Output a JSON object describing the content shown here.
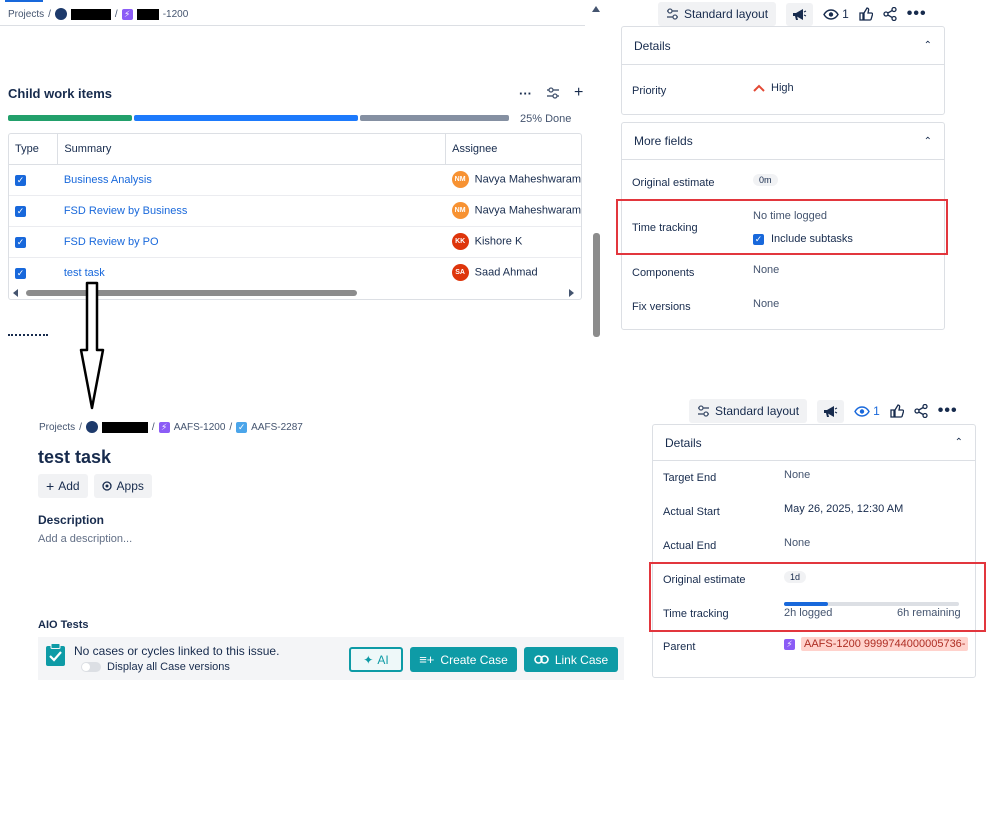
{
  "top": {
    "breadcrumb": {
      "projects": "Projects",
      "sep": "/",
      "issue_suffix": "-1200"
    },
    "toolbar": {
      "standard_layout": "Standard layout",
      "watch_count": "1"
    },
    "child_items": {
      "title": "Child work items",
      "progress_label": "25% Done",
      "progress": {
        "done": 0.25,
        "in_progress": 0.45,
        "todo": 0.3
      },
      "columns": [
        "Type",
        "Summary",
        "Assignee"
      ],
      "rows": [
        {
          "summary": "Business Analysis",
          "initials": "NM",
          "assignee": "Navya Maheshwaram",
          "color": "#f79232"
        },
        {
          "summary": "FSD Review by Business",
          "initials": "NM",
          "assignee": "Navya Maheshwaram",
          "color": "#f79232"
        },
        {
          "summary": "FSD Review by PO",
          "initials": "KK",
          "assignee": "Kishore K",
          "color": "#de350b"
        },
        {
          "summary": "test task",
          "initials": "SA",
          "assignee": "Saad Ahmad",
          "color": "#de350b"
        }
      ]
    },
    "details": {
      "header": "Details",
      "priority_label": "Priority",
      "priority_value": "High"
    },
    "more_fields": {
      "header": "More fields",
      "original_estimate_label": "Original estimate",
      "original_estimate_value": "0m",
      "time_tracking_label": "Time tracking",
      "time_tracking_value": "No time logged",
      "include_subtasks": "Include subtasks",
      "components_label": "Components",
      "components_value": "None",
      "fix_versions_label": "Fix versions",
      "fix_versions_value": "None"
    }
  },
  "bottom": {
    "breadcrumb": {
      "projects": "Projects",
      "sep": "/",
      "epic": "AAFS-1200",
      "task": "AAFS-2287"
    },
    "title": "test task",
    "add_btn": "Add",
    "apps_btn": "Apps",
    "description_label": "Description",
    "description_placeholder": "Add a description...",
    "aio": {
      "title": "AIO Tests",
      "message": "No cases or cycles linked to this issue.",
      "toggle_label": "Display all Case versions",
      "ai_btn": "AI",
      "create_btn": "Create Case",
      "link_btn": "Link Case"
    },
    "toolbar": {
      "standard_layout": "Standard layout",
      "watch_count": "1"
    },
    "details": {
      "header": "Details",
      "target_end_label": "Target End",
      "target_end_value": "None",
      "actual_start_label": "Actual Start",
      "actual_start_value": "May 26, 2025, 12:30 AM",
      "actual_end_label": "Actual End",
      "actual_end_value": "None",
      "original_estimate_label": "Original estimate",
      "original_estimate_value": "1d",
      "time_tracking_label": "Time tracking",
      "logged": "2h logged",
      "remaining": "6h remaining",
      "time_progress": 0.25,
      "parent_label": "Parent",
      "parent_value": "AAFS-1200 9999744000005736-"
    }
  },
  "colors": {
    "accent": "#1868db",
    "red_box": "#e2363d",
    "teal": "#0e9ba6",
    "done_green": "#22a06b",
    "progress_blue": "#1d7afc",
    "todo_gray": "#8590a2"
  }
}
